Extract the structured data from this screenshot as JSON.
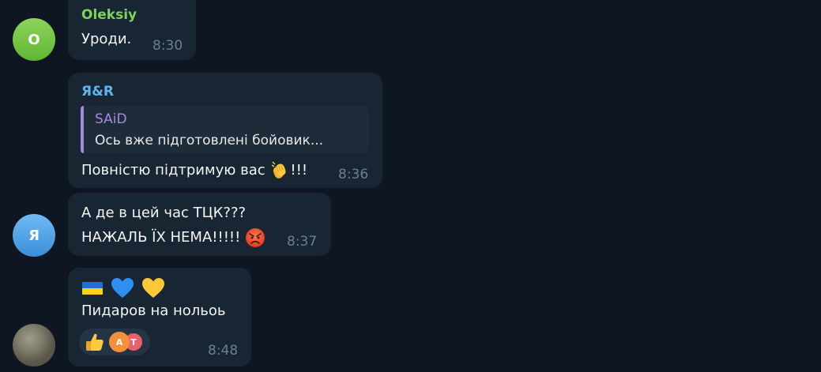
{
  "messages": [
    {
      "sender": "Oleksiy",
      "sender_color": "#7ed35a",
      "avatar_letter": "O",
      "text": "Уроди.",
      "time": "8:30"
    },
    {
      "sender": "Я&R",
      "sender_color": "#5eb4f0",
      "reply": {
        "name": "SAiD",
        "text": "Ось вже підготовлені бойовик..."
      },
      "text": "Повністю підтримую вас",
      "text_suffix": "!!!",
      "emoji": "clapping-hands-emoji",
      "time": "8:36"
    },
    {
      "avatar_letter": "Я",
      "line1": "А де в цей час ТЦК???",
      "line2": "НАЖАЛЬ ЇХ НЕМА!!!!!",
      "emoji": "angry-face-emoji",
      "time": "8:37"
    },
    {
      "emojis": [
        "ukraine-flag-emoji",
        "blue-heart-emoji",
        "yellow-heart-emoji"
      ],
      "text": "Пидаров на нольоь",
      "reaction": {
        "emoji": "thumbs-up-emoji",
        "avatars": [
          "A",
          "T"
        ]
      },
      "time": "8:48"
    }
  ]
}
